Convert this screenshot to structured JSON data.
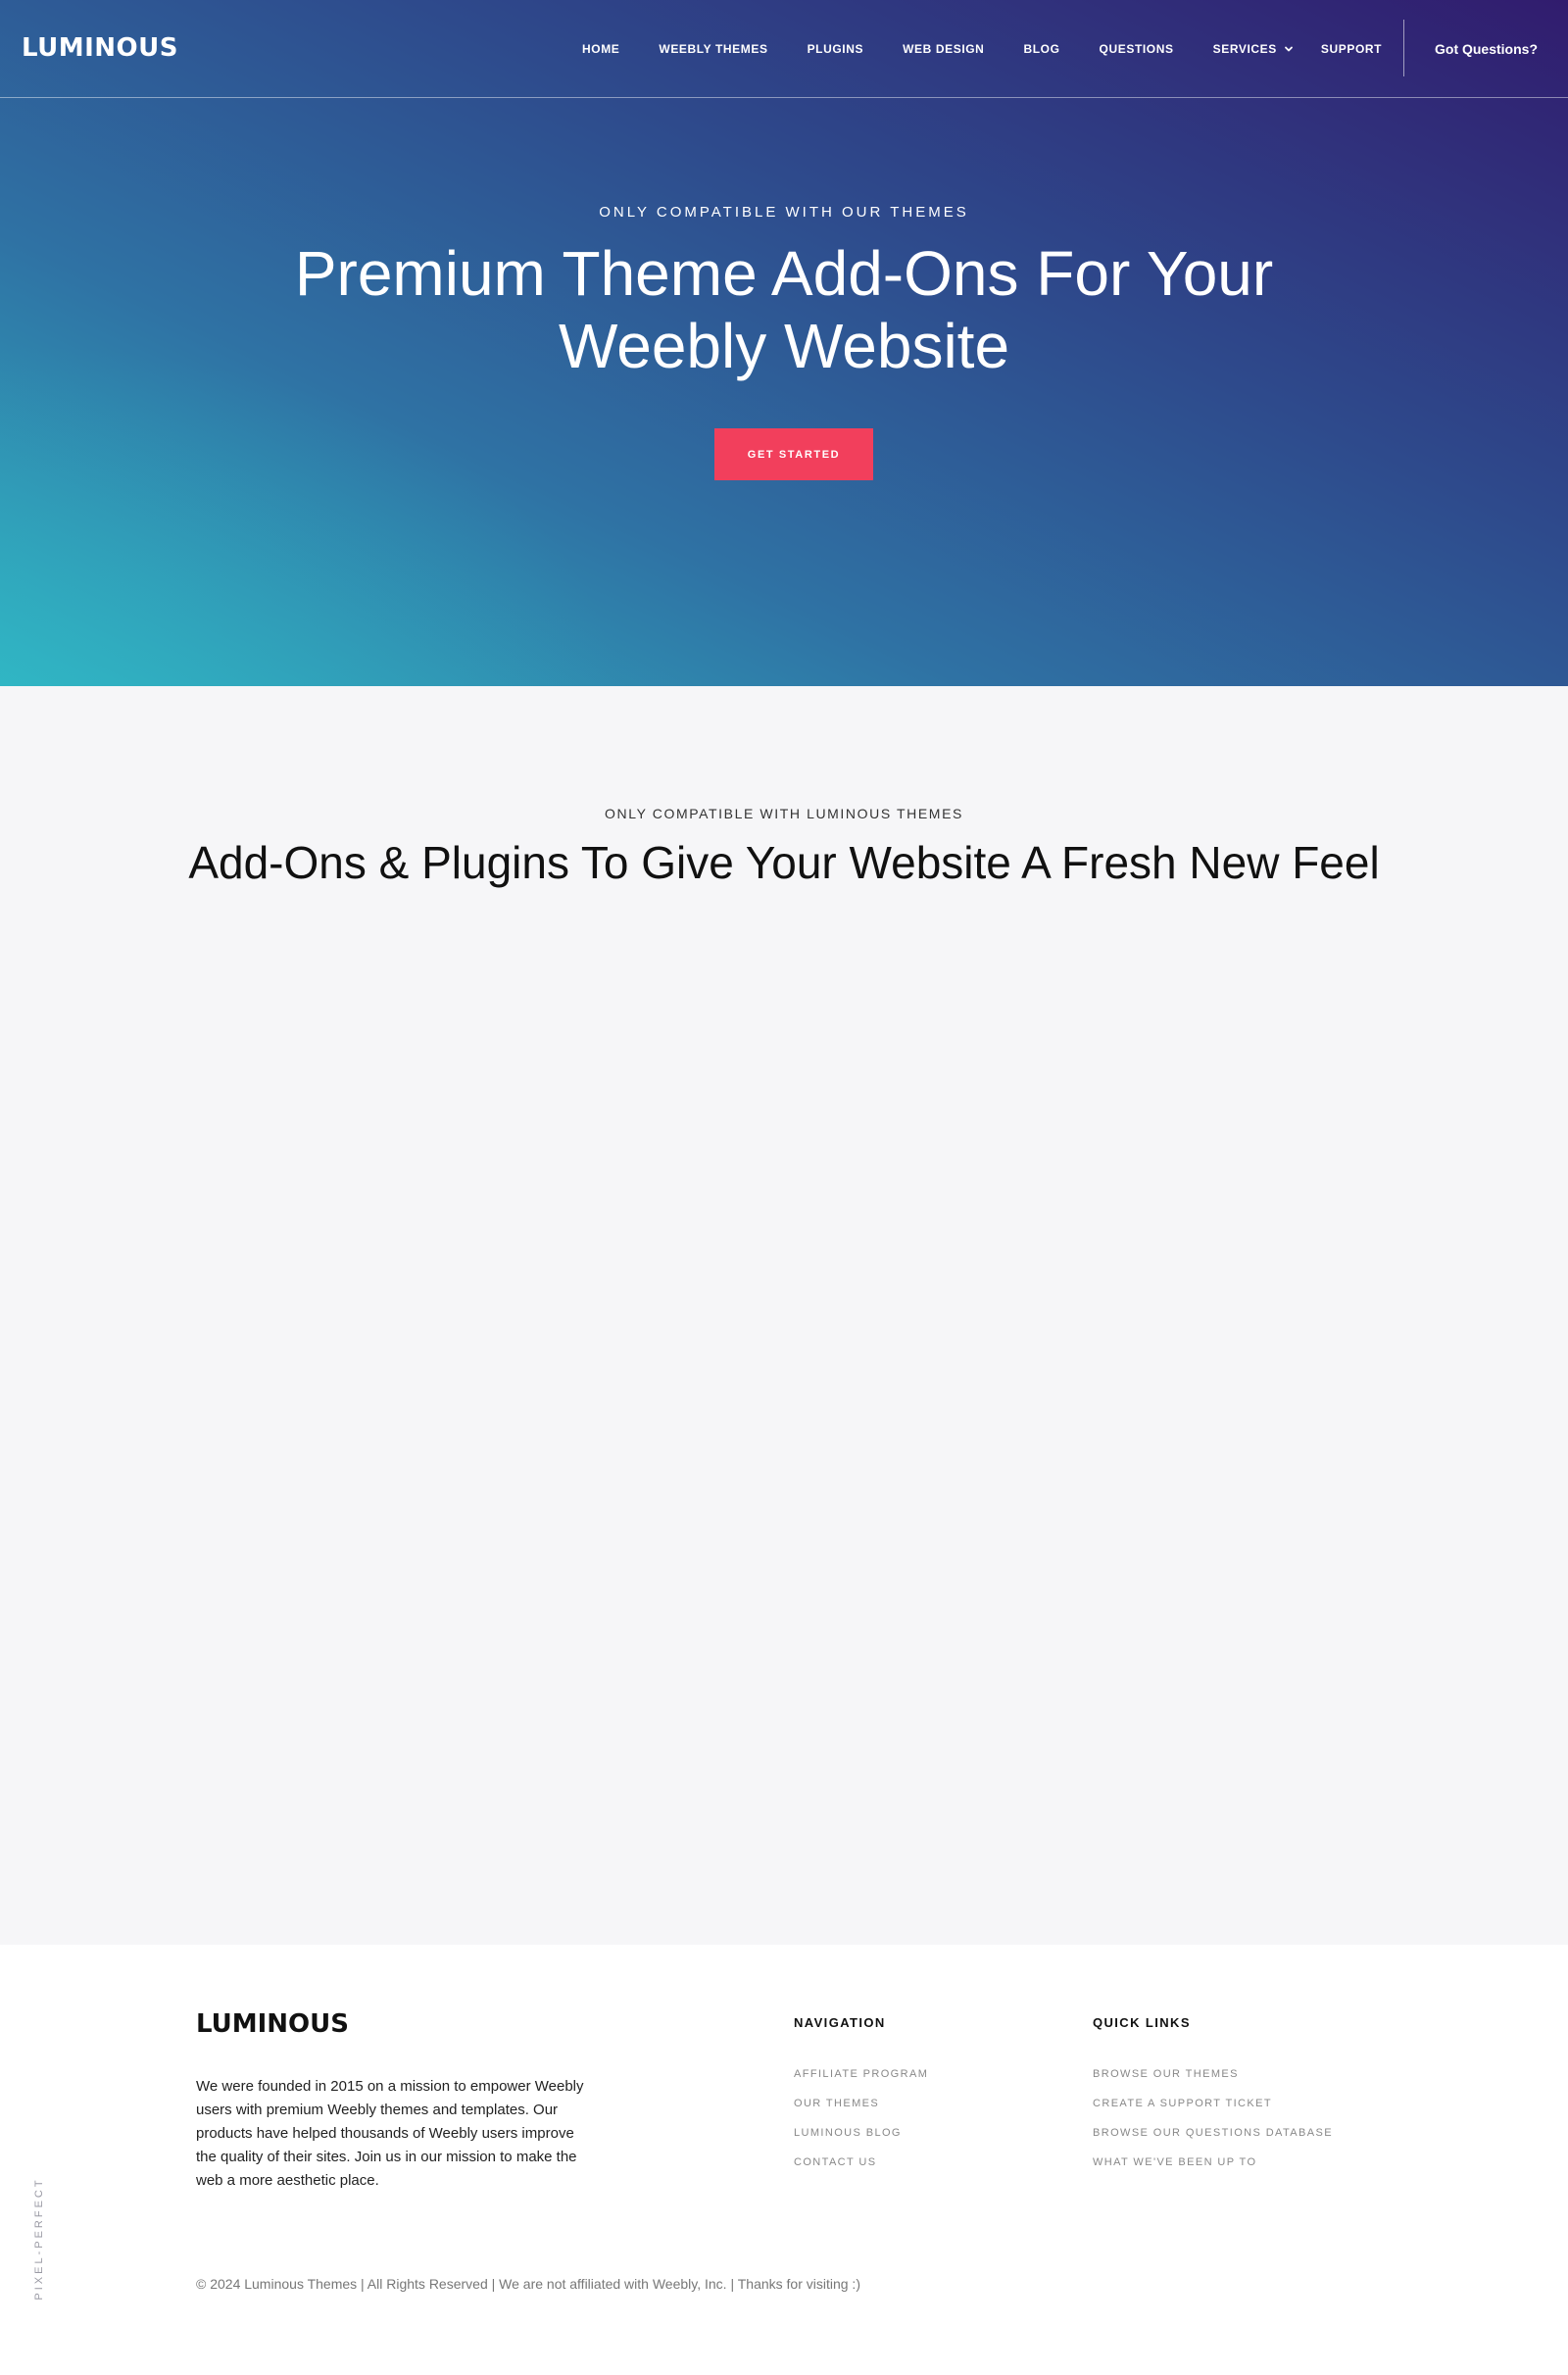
{
  "header": {
    "logo": "LUMINOUS",
    "nav": [
      "HOME",
      "WEEBLY THEMES",
      "PLUGINS",
      "WEB DESIGN",
      "BLOG",
      "QUESTIONS",
      "SERVICES",
      "SUPPORT"
    ],
    "cta": "Got Questions?"
  },
  "hero": {
    "eyebrow": "ONLY COMPATIBLE WITH OUR THEMES",
    "title": "Premium Theme Add-Ons For Your Weebly Website",
    "button": "GET STARTED",
    "button_color": "#f23f5c",
    "gradient_colors": [
      "#311c6e",
      "#2f72a4",
      "#30b2c2"
    ]
  },
  "addons": {
    "eyebrow": "ONLY COMPATIBLE WITH LUMINOUS THEMES",
    "title": "Add-Ons & Plugins To Give Your Website A Fresh New Feel"
  },
  "footer": {
    "side_text": "PIXEL-PERFECT",
    "logo": "LUMINOUS",
    "about": "We were founded in 2015 on a mission to empower Weebly users with premium Weebly themes and templates. Our products have helped thousands of Weebly users improve the quality of their sites. Join us in our mission to make the web a more aesthetic place.",
    "navigation": {
      "heading": "NAVIGATION",
      "links": [
        "AFFILIATE PROGRAM",
        "OUR THEMES",
        "LUMINOUS BLOG",
        "CONTACT US"
      ]
    },
    "quick_links": {
      "heading": "QUICK LINKS",
      "links": [
        "BROWSE OUR THEMES",
        "CREATE A SUPPORT TICKET",
        "BROWSE OUR QUESTIONS DATABASE",
        "WHAT WE'VE BEEN UP TO"
      ]
    },
    "copyright": "© 2024 Luminous Themes | All Rights Reserved | We are not affiliated with Weebly, Inc. | Thanks for visiting :)"
  }
}
